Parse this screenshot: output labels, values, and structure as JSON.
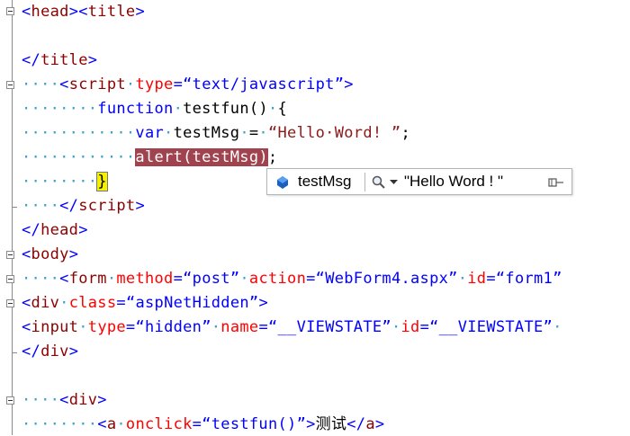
{
  "editor": {
    "lines": [
      {
        "segments": [
          {
            "c": "b",
            "t": "<"
          },
          {
            "c": "t",
            "t": "head"
          },
          {
            "c": "b",
            "t": "><"
          },
          {
            "c": "t",
            "t": "title"
          },
          {
            "c": "b",
            "t": ">"
          }
        ]
      },
      {
        "segments": []
      },
      {
        "segments": [
          {
            "c": "b",
            "t": "</"
          },
          {
            "c": "t",
            "t": "title"
          },
          {
            "c": "b",
            "t": ">"
          }
        ]
      },
      {
        "segments": [
          {
            "c": "dots",
            "t": "····"
          },
          {
            "c": "b",
            "t": "<"
          },
          {
            "c": "t",
            "t": "script"
          },
          {
            "c": "dots",
            "t": "·"
          },
          {
            "c": "a",
            "t": "type"
          },
          {
            "c": "b",
            "t": "="
          },
          {
            "c": "v",
            "t": "“text/javascript”"
          },
          {
            "c": "b",
            "t": ">"
          }
        ]
      },
      {
        "segments": [
          {
            "c": "dots",
            "t": "········"
          },
          {
            "c": "b",
            "t": "function"
          },
          {
            "c": "dots",
            "t": "·"
          },
          {
            "c": "n",
            "t": "testfun()"
          },
          {
            "c": "dots",
            "t": "·"
          },
          {
            "c": "n",
            "t": "{"
          }
        ]
      },
      {
        "segments": [
          {
            "c": "dots",
            "t": "············"
          },
          {
            "c": "b",
            "t": "var"
          },
          {
            "c": "dots",
            "t": "·"
          },
          {
            "c": "n",
            "t": "testMsg"
          },
          {
            "c": "dots",
            "t": "·"
          },
          {
            "c": "n",
            "t": "="
          },
          {
            "c": "dots",
            "t": "·"
          },
          {
            "c": "s",
            "t": "“Hello·Word! ”"
          },
          {
            "c": "n",
            "t": ";"
          }
        ]
      },
      {
        "segments": [
          {
            "c": "dots",
            "t": "············"
          },
          {
            "c": "hl",
            "t": "alert(testMsg)"
          },
          {
            "c": "n",
            "t": ";"
          }
        ]
      },
      {
        "segments": [
          {
            "c": "dots",
            "t": "········"
          },
          {
            "c": "cursor-hl",
            "t": "}"
          }
        ]
      },
      {
        "segments": [
          {
            "c": "dots",
            "t": "····"
          },
          {
            "c": "b",
            "t": "</"
          },
          {
            "c": "t",
            "t": "script"
          },
          {
            "c": "b",
            "t": ">"
          }
        ]
      },
      {
        "segments": [
          {
            "c": "b",
            "t": "</"
          },
          {
            "c": "t",
            "t": "head"
          },
          {
            "c": "b",
            "t": ">"
          }
        ]
      },
      {
        "segments": [
          {
            "c": "b",
            "t": "<"
          },
          {
            "c": "t",
            "t": "body"
          },
          {
            "c": "b",
            "t": ">"
          }
        ]
      },
      {
        "segments": [
          {
            "c": "dots",
            "t": "····"
          },
          {
            "c": "b",
            "t": "<"
          },
          {
            "c": "t",
            "t": "form"
          },
          {
            "c": "dots",
            "t": "·"
          },
          {
            "c": "a",
            "t": "method"
          },
          {
            "c": "b",
            "t": "="
          },
          {
            "c": "v",
            "t": "“post”"
          },
          {
            "c": "dots",
            "t": "·"
          },
          {
            "c": "a",
            "t": "action"
          },
          {
            "c": "b",
            "t": "="
          },
          {
            "c": "v",
            "t": "“WebForm4.aspx”"
          },
          {
            "c": "dots",
            "t": "·"
          },
          {
            "c": "a",
            "t": "id"
          },
          {
            "c": "b",
            "t": "="
          },
          {
            "c": "v",
            "t": "“form1”"
          }
        ]
      },
      {
        "segments": [
          {
            "c": "b",
            "t": "<"
          },
          {
            "c": "t",
            "t": "div"
          },
          {
            "c": "dots",
            "t": "·"
          },
          {
            "c": "a",
            "t": "class"
          },
          {
            "c": "b",
            "t": "="
          },
          {
            "c": "v",
            "t": "“aspNetHidden”"
          },
          {
            "c": "b",
            "t": ">"
          }
        ]
      },
      {
        "segments": [
          {
            "c": "b",
            "t": "<"
          },
          {
            "c": "t",
            "t": "input"
          },
          {
            "c": "dots",
            "t": "·"
          },
          {
            "c": "a",
            "t": "type"
          },
          {
            "c": "b",
            "t": "="
          },
          {
            "c": "v",
            "t": "“hidden”"
          },
          {
            "c": "dots",
            "t": "·"
          },
          {
            "c": "a",
            "t": "name"
          },
          {
            "c": "b",
            "t": "="
          },
          {
            "c": "v",
            "t": "“__VIEWSTATE”"
          },
          {
            "c": "dots",
            "t": "·"
          },
          {
            "c": "a",
            "t": "id"
          },
          {
            "c": "b",
            "t": "="
          },
          {
            "c": "v",
            "t": "“__VIEWSTATE”"
          },
          {
            "c": "dots",
            "t": "·"
          }
        ]
      },
      {
        "segments": [
          {
            "c": "b",
            "t": "</"
          },
          {
            "c": "t",
            "t": "div"
          },
          {
            "c": "b",
            "t": ">"
          }
        ]
      },
      {
        "segments": []
      },
      {
        "segments": [
          {
            "c": "dots",
            "t": "····"
          },
          {
            "c": "b",
            "t": "<"
          },
          {
            "c": "t",
            "t": "div"
          },
          {
            "c": "b",
            "t": ">"
          }
        ]
      },
      {
        "segments": [
          {
            "c": "dots",
            "t": "········"
          },
          {
            "c": "b",
            "t": "<"
          },
          {
            "c": "t",
            "t": "a"
          },
          {
            "c": "dots",
            "t": "·"
          },
          {
            "c": "a",
            "t": "onclick"
          },
          {
            "c": "b",
            "t": "="
          },
          {
            "c": "v",
            "t": "“testfun()”"
          },
          {
            "c": "b",
            "t": ">"
          },
          {
            "c": "n",
            "t": "测试"
          },
          {
            "c": "b",
            "t": "</"
          },
          {
            "c": "t",
            "t": "a"
          },
          {
            "c": "b",
            "t": ">"
          }
        ]
      }
    ]
  },
  "datatip": {
    "variable_name": "testMsg",
    "value": "\"Hello Word ! \"",
    "icons": [
      "variable-icon",
      "magnifier-icon",
      "dropdown-icon",
      "pin-icon"
    ]
  }
}
